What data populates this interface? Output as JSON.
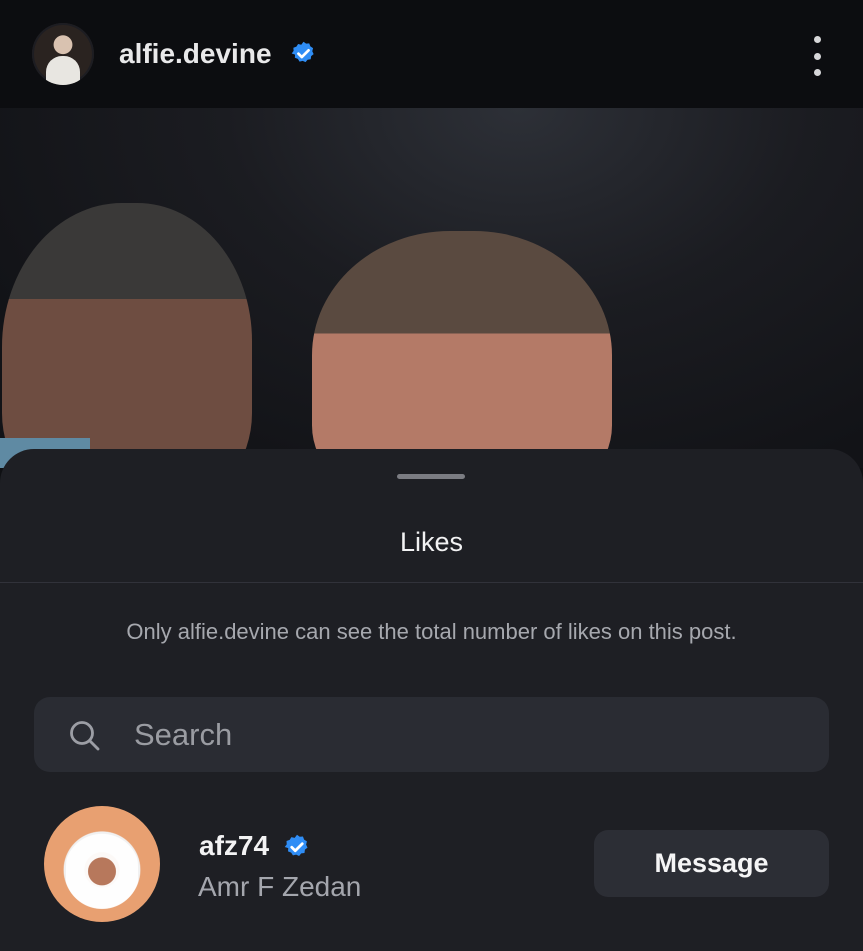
{
  "post_header": {
    "username": "alfie.devine",
    "verified_icon": "verified-badge-icon",
    "more_icon": "more-vertical-icon"
  },
  "likes_sheet": {
    "title": "Likes",
    "notice": "Only alfie.devine can see the total number of likes on this post.",
    "search": {
      "placeholder": "Search",
      "value": ""
    },
    "users": [
      {
        "username": "afz74",
        "full_name": "Amr F Zedan",
        "verified": true,
        "action_label": "Message"
      }
    ]
  },
  "colors": {
    "verified": "#2f8df5",
    "sheet_bg": "#1e1f24",
    "button_bg": "#2c2e35"
  }
}
